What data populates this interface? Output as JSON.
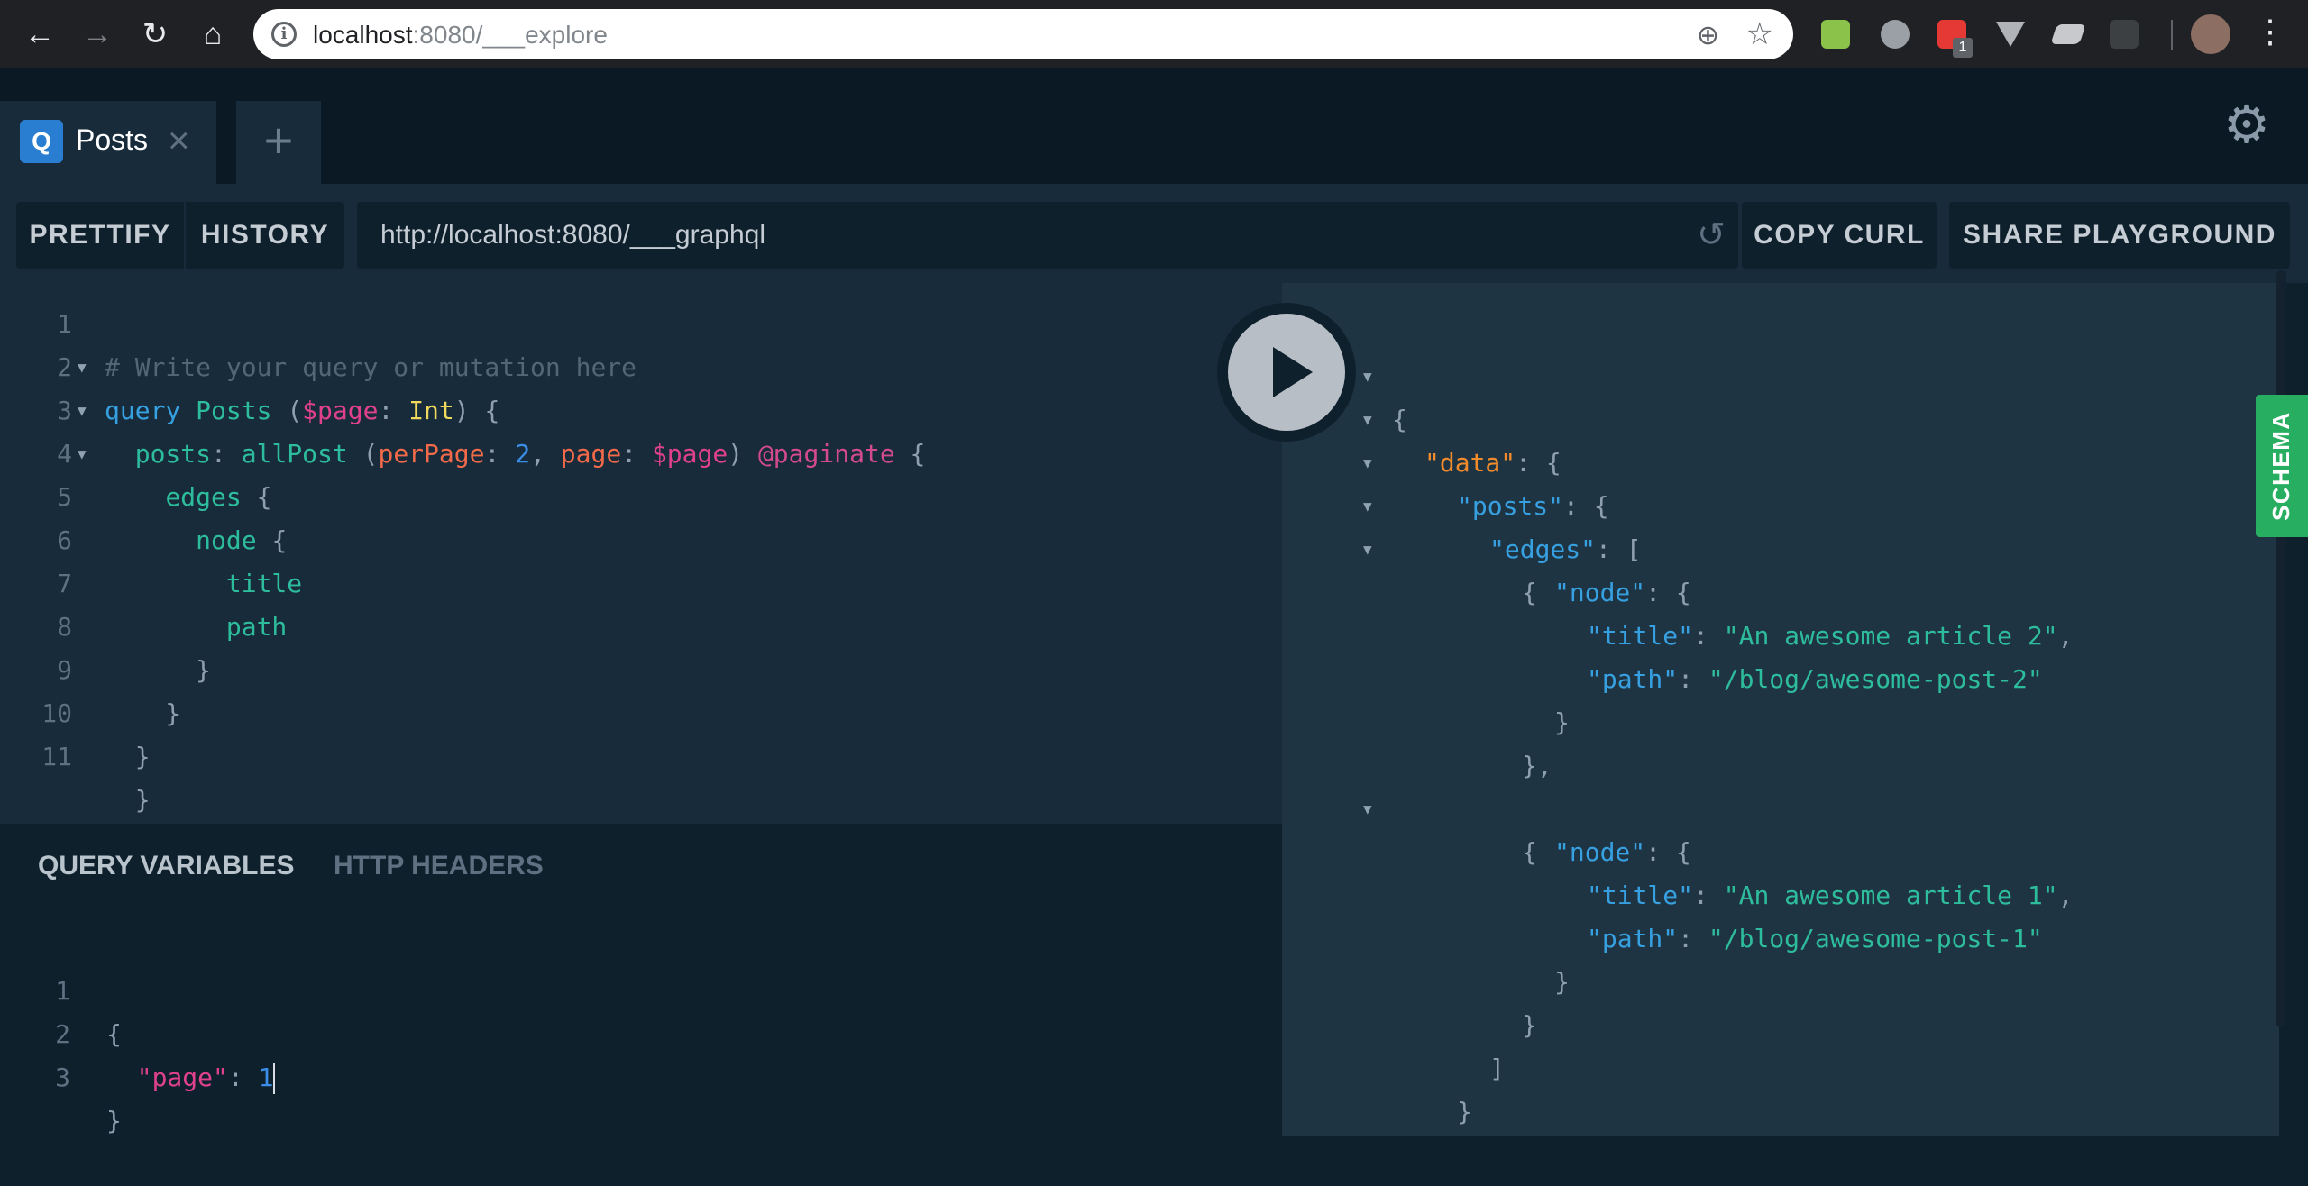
{
  "browser": {
    "url_host": "localhost",
    "url_path": ":8080/___explore",
    "ext_badge": "1"
  },
  "tabs": {
    "active_label": "Posts",
    "badge": "Q"
  },
  "toolbar": {
    "prettify": "PRETTIFY",
    "history": "HISTORY",
    "endpoint": "http://localhost:8080/___graphql",
    "copy_curl": "COPY CURL",
    "share": "SHARE PLAYGROUND"
  },
  "editor": {
    "line_numbers": [
      "1",
      "2",
      "3",
      "4",
      "5",
      "6",
      "7",
      "8",
      "9",
      "10",
      "11"
    ],
    "comment": "# Write your query or mutation here",
    "query_kw": "query",
    "op_name": "Posts",
    "var_name": "$page",
    "var_type": "Int",
    "field_posts": "posts",
    "field_allpost": "allPost",
    "arg_perpage": "perPage",
    "perpage_value": "2",
    "arg_page": "page",
    "page_var": "$page",
    "directive": "@paginate",
    "field_edges": "edges",
    "field_node": "node",
    "field_title": "title",
    "field_path": "path"
  },
  "variables": {
    "tab_query_vars": "QUERY VARIABLES",
    "tab_http_headers": "HTTP HEADERS",
    "line_numbers": [
      "1",
      "2",
      "3"
    ],
    "key": "\"page\"",
    "value": "1"
  },
  "result": {
    "data_key": "\"data\"",
    "posts_key": "\"posts\"",
    "edges_key": "\"edges\"",
    "node_key": "\"node\"",
    "title_key": "\"title\"",
    "path_key": "\"path\"",
    "items": [
      {
        "title": "\"An awesome article 2\"",
        "path": "\"/blog/awesome-post-2\""
      },
      {
        "title": "\"An awesome article 1\"",
        "path": "\"/blog/awesome-post-1\""
      }
    ]
  },
  "schema_label": "SCHEMA",
  "colors": {
    "accent": "#27ae60",
    "background": "#0f202d",
    "editor": "#172b3a",
    "result": "#1f3443"
  }
}
